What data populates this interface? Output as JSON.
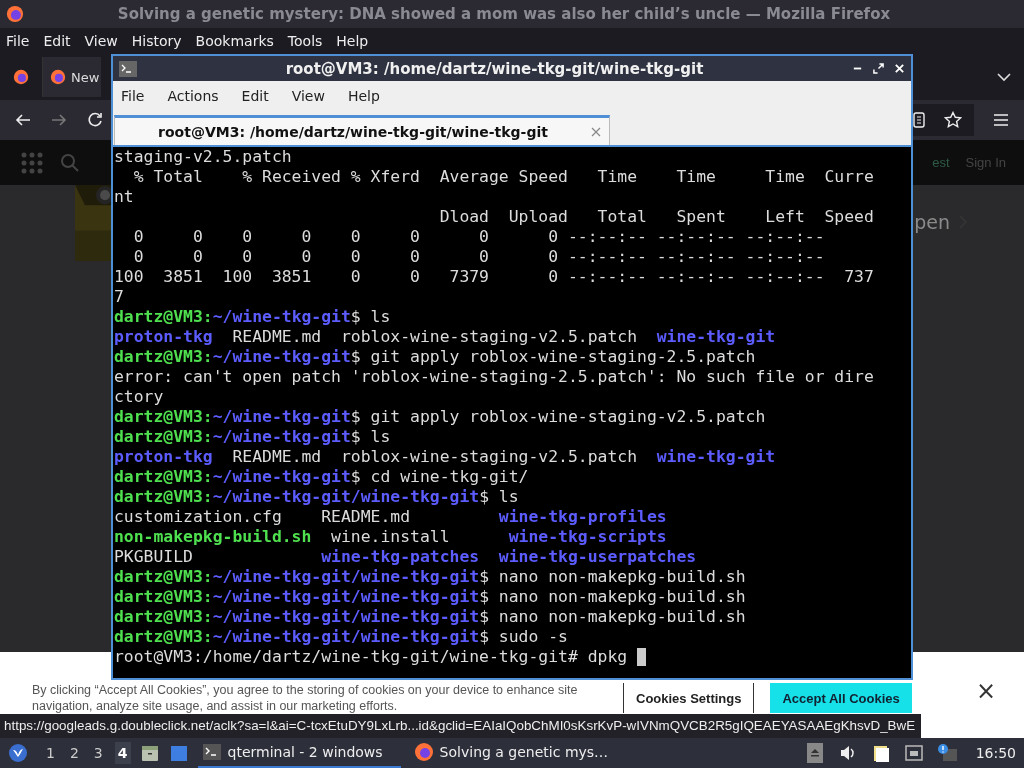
{
  "browser": {
    "title": "Solving a genetic mystery: DNA showed a mom was also her child’s uncle — Mozilla Firefox",
    "menu": [
      "File",
      "Edit",
      "View",
      "History",
      "Bookmarks",
      "Tools",
      "Help"
    ],
    "tab": {
      "label": "New",
      "selected": true
    },
    "page": {
      "header_links": [
        "est",
        "Sign In"
      ],
      "side_link": "pen",
      "cookie_text": "By clicking “Accept All Cookies”, you agree to the storing of cookies on your device to enhance site navigation, analyze site usage, and assist in our marketing efforts.",
      "cookie_buttons": [
        {
          "label": "Cookies Settings",
          "kind": "outline"
        },
        {
          "label": "Accept All Cookies",
          "kind": "primary"
        }
      ],
      "close": "×"
    },
    "status_url": "https://googleads.g.doubleclick.net/aclk?sa=l&ai=C-tcxEtuDY9LxLrb...id&gclid=EAIaIQobChMI0sKsrKvP-wIVNmQVCB2R5gIQEAEYASAAEgKhsvD_BwE"
  },
  "terminal": {
    "title": "root@VM3: /home/dartz/wine-tkg-git/wine-tkg-git",
    "menu": [
      "File",
      "Actions",
      "Edit",
      "View",
      "Help"
    ],
    "tabs": [
      {
        "label": "root@VM3: /home/dartz/wine-tkg-git/wine-tkg-git",
        "selected": true
      }
    ],
    "lines": [
      [
        {
          "text": "staging-v2.5.patch",
          "kind": "plain"
        }
      ],
      [
        {
          "text": "  % Total    % Received % Xferd  Average Speed   Time    Time     Time  Curre",
          "kind": "plain"
        }
      ],
      [
        {
          "text": "nt",
          "kind": "plain"
        }
      ],
      [
        {
          "text": "                                 Dload  Upload   Total   Spent    Left  Speed",
          "kind": "plain"
        }
      ],
      [
        {
          "text": "  0     0    0     0    0     0      0      0 --:--:-- --:--:-- --:--:--",
          "kind": "plain"
        }
      ],
      [
        {
          "text": "  0     0    0     0    0     0      0      0 --:--:-- --:--:-- --:--:--",
          "kind": "plain"
        }
      ],
      [
        {
          "text": "100  3851  100  3851    0     0   7379      0 --:--:-- --:--:-- --:--:--  737",
          "kind": "plain"
        }
      ],
      [
        {
          "text": "7",
          "kind": "plain"
        }
      ],
      [
        {
          "text": "dartz@VM3:",
          "kind": "user"
        },
        {
          "text": "~/wine-tkg-git",
          "kind": "path"
        },
        {
          "text": "$ ls",
          "kind": "plain"
        }
      ],
      [
        {
          "text": "proton-tkg",
          "kind": "dir"
        },
        {
          "text": "  README.md  roblox-wine-staging-v2.5.patch  ",
          "kind": "plain"
        },
        {
          "text": "wine-tkg-git",
          "kind": "dir"
        }
      ],
      [
        {
          "text": "dartz@VM3:",
          "kind": "user"
        },
        {
          "text": "~/wine-tkg-git",
          "kind": "path"
        },
        {
          "text": "$ git apply roblox-wine-staging-2.5.patch",
          "kind": "plain"
        }
      ],
      [
        {
          "text": "error: can't open patch 'roblox-wine-staging-2.5.patch': No such file or dire",
          "kind": "plain"
        }
      ],
      [
        {
          "text": "ctory",
          "kind": "plain"
        }
      ],
      [
        {
          "text": "dartz@VM3:",
          "kind": "user"
        },
        {
          "text": "~/wine-tkg-git",
          "kind": "path"
        },
        {
          "text": "$ git apply roblox-wine-staging-v2.5.patch",
          "kind": "plain"
        }
      ],
      [
        {
          "text": "dartz@VM3:",
          "kind": "user"
        },
        {
          "text": "~/wine-tkg-git",
          "kind": "path"
        },
        {
          "text": "$ ls",
          "kind": "plain"
        }
      ],
      [
        {
          "text": "proton-tkg",
          "kind": "dir"
        },
        {
          "text": "  README.md  roblox-wine-staging-v2.5.patch  ",
          "kind": "plain"
        },
        {
          "text": "wine-tkg-git",
          "kind": "dir"
        }
      ],
      [
        {
          "text": "dartz@VM3:",
          "kind": "user"
        },
        {
          "text": "~/wine-tkg-git",
          "kind": "path"
        },
        {
          "text": "$ cd wine-tkg-git/",
          "kind": "plain"
        }
      ],
      [
        {
          "text": "dartz@VM3:",
          "kind": "user"
        },
        {
          "text": "~/wine-tkg-git/wine-tkg-git",
          "kind": "path"
        },
        {
          "text": "$ ls",
          "kind": "plain"
        }
      ],
      [
        {
          "text": "customization.cfg    README.md         ",
          "kind": "plain"
        },
        {
          "text": "wine-tkg-profiles",
          "kind": "dir"
        }
      ],
      [
        {
          "text": "non-makepkg-build.sh",
          "kind": "exec"
        },
        {
          "text": "  wine.install      ",
          "kind": "plain"
        },
        {
          "text": "wine-tkg-scripts",
          "kind": "dir"
        }
      ],
      [
        {
          "text": "PKGBUILD             ",
          "kind": "plain"
        },
        {
          "text": "wine-tkg-patches  ",
          "kind": "dir"
        },
        {
          "text": "wine-tkg-userpatches",
          "kind": "dir"
        }
      ],
      [
        {
          "text": "dartz@VM3:",
          "kind": "user"
        },
        {
          "text": "~/wine-tkg-git/wine-tkg-git",
          "kind": "path"
        },
        {
          "text": "$ nano non-makepkg-build.sh",
          "kind": "plain"
        }
      ],
      [
        {
          "text": "dartz@VM3:",
          "kind": "user"
        },
        {
          "text": "~/wine-tkg-git/wine-tkg-git",
          "kind": "path"
        },
        {
          "text": "$ nano non-makepkg-build.sh",
          "kind": "plain"
        }
      ],
      [
        {
          "text": "dartz@VM3:",
          "kind": "user"
        },
        {
          "text": "~/wine-tkg-git/wine-tkg-git",
          "kind": "path"
        },
        {
          "text": "$ nano non-makepkg-build.sh",
          "kind": "plain"
        }
      ],
      [
        {
          "text": "dartz@VM3:",
          "kind": "user"
        },
        {
          "text": "~/wine-tkg-git/wine-tkg-git",
          "kind": "path"
        },
        {
          "text": "$ sudo -s",
          "kind": "plain"
        }
      ],
      [
        {
          "text": "root@VM3:/home/dartz/wine-tkg-git/wine-tkg-git# dpkg ",
          "kind": "plain"
        }
      ]
    ]
  },
  "taskbar": {
    "workspaces": [
      {
        "label": "1",
        "selected": false
      },
      {
        "label": "2",
        "selected": false
      },
      {
        "label": "3",
        "selected": false
      },
      {
        "label": "4",
        "selected": true
      }
    ],
    "tasks": [
      {
        "label": "qterminal - 2 windows",
        "kind": "terminal",
        "selected": true
      },
      {
        "label": "Solving a genetic mys…",
        "kind": "browser",
        "selected": false
      }
    ],
    "clock": "16:50"
  }
}
